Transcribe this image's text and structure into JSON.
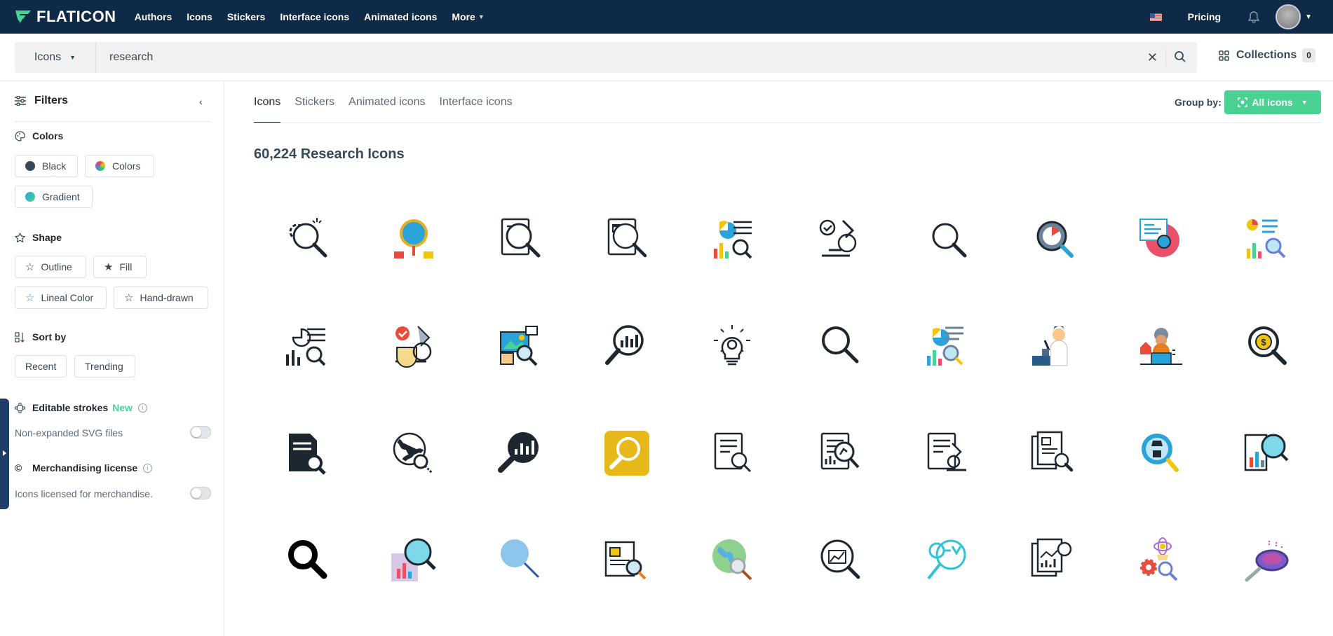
{
  "brand": {
    "name": "FLATICON"
  },
  "nav": {
    "items": [
      {
        "label": "Authors"
      },
      {
        "label": "Icons"
      },
      {
        "label": "Stickers"
      },
      {
        "label": "Interface icons"
      },
      {
        "label": "Animated icons"
      },
      {
        "label": "More"
      }
    ],
    "pricing": "Pricing"
  },
  "search": {
    "type": "Icons",
    "value": "research"
  },
  "collections": {
    "label": "Collections",
    "count": "0"
  },
  "filters": {
    "title": "Filters",
    "colors": {
      "title": "Colors",
      "options": [
        {
          "label": "Black",
          "color": "#374957"
        },
        {
          "label": "Colors",
          "color": "conic"
        },
        {
          "label": "Gradient",
          "color": "#2aa3d8"
        }
      ]
    },
    "shape": {
      "title": "Shape",
      "options": [
        {
          "label": "Outline"
        },
        {
          "label": "Fill"
        },
        {
          "label": "Lineal Color"
        },
        {
          "label": "Hand-drawn"
        }
      ]
    },
    "sort": {
      "title": "Sort by",
      "options": [
        {
          "label": "Recent"
        },
        {
          "label": "Trending"
        }
      ]
    },
    "editable": {
      "title": "Editable strokes",
      "new": "New",
      "sub": "Non-expanded SVG files"
    },
    "merch": {
      "title": "Merchandising license",
      "sub": "Icons licensed for merchandise."
    }
  },
  "tabs": [
    {
      "label": "Icons",
      "active": true
    },
    {
      "label": "Stickers"
    },
    {
      "label": "Animated icons"
    },
    {
      "label": "Interface icons"
    }
  ],
  "groupby": {
    "label": "Group by:",
    "value": "All icons"
  },
  "results": {
    "heading": "60,224 Research Icons"
  },
  "icons": [
    "gears-magnifier-icon",
    "globe-magnifier-icon",
    "report-magnifier-icon",
    "newspaper-magnifier-icon",
    "analytics-chart-person-icon",
    "microscope-check-icon",
    "magnifier-icon",
    "magnifier-chart-icon",
    "website-magnifier-icon",
    "chart-report-magnifier-icon",
    "pie-chart-report-icon",
    "microscope-color-icon",
    "image-magnifier-icon",
    "magnifier-bar-chart-icon",
    "lightbulb-gear-icon",
    "magnifier-simple-icon",
    "data-analysis-icon",
    "scientist-icon",
    "researcher-laptop-icon",
    "magnifier-coin-icon",
    "document-search-icon",
    "globe-search-icon",
    "magnifier-chart-filled-icon",
    "magnifier-yellow-icon",
    "document-magnifier-icon",
    "report-microscope-icon",
    "paper-microscope-icon",
    "documents-magnifier-icon",
    "chess-magnifier-icon",
    "bar-chart-magnifier-icon",
    "magnifier-bold-icon",
    "chart-magnifier-gradient-icon",
    "magnifier-blue-icon",
    "newspaper-gradient-icon",
    "globe-magnifier-color-icon",
    "magnifier-line-chart-icon",
    "network-magnifier-icon",
    "reports-magnifier-icon",
    "lightbulb-gears-icon",
    "petri-dish-icon"
  ]
}
